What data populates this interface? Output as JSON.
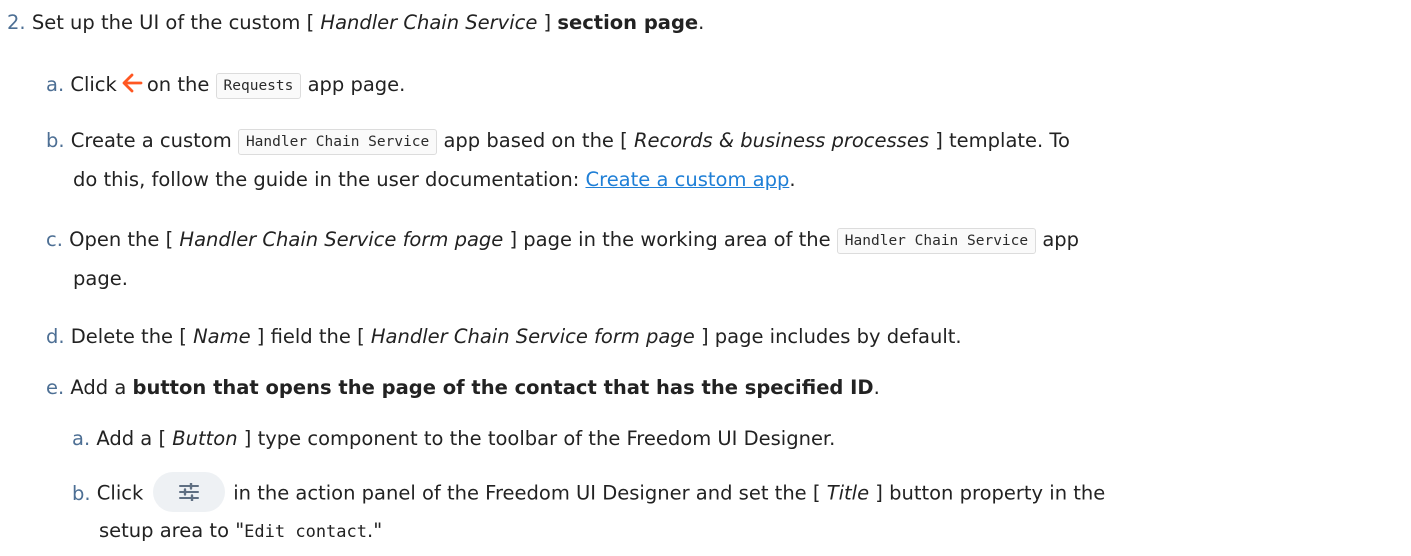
{
  "step2": {
    "marker": "2.",
    "t1": "Set up the UI of the custom [ ",
    "t2": "Handler Chain Service",
    "t3": " ] ",
    "t4": "section page",
    "t5": "."
  },
  "a": {
    "marker": "a.",
    "t1": "Click",
    "icon": "back-arrow-icon",
    "t2": "on the",
    "code": "Requests",
    "t3": "app page."
  },
  "b": {
    "marker": "b.",
    "t1": "Create a custom",
    "code": "Handler Chain Service",
    "t2": "app based on the [ ",
    "t3": "Records & business processes",
    "t4": " ] template. To",
    "line2_t1": "do this, follow the guide in the user documentation: ",
    "link": "Create a custom app",
    "line2_t2": "."
  },
  "c": {
    "marker": "c.",
    "t1": "Open the [ ",
    "t2": "Handler Chain Service form page",
    "t3": " ] page in the working area of the",
    "code": "Handler Chain Service",
    "t4": "app",
    "line2": "page."
  },
  "d": {
    "marker": "d.",
    "t1": "Delete the [ ",
    "t2": "Name",
    "t3": " ] field the [ ",
    "t4": "Handler Chain Service form page",
    "t5": " ] page includes by default."
  },
  "e": {
    "marker": "e.",
    "t1": "Add a ",
    "t2": "button that opens the page of the contact that has the specified ID",
    "t3": "."
  },
  "ea": {
    "marker": "a.",
    "t1": "Add a [ ",
    "t2": "Button",
    "t3": " ] type component to the toolbar of the Freedom UI Designer."
  },
  "eb": {
    "marker": "b.",
    "t1": "Click",
    "icon": "settings-sliders-icon",
    "t2": "in the action panel of the Freedom UI Designer and set the [ ",
    "t3": "Title",
    "t4": " ] button property in the",
    "line2_t1": "setup area to \"",
    "code": "Edit contact",
    "line2_t2": ".\""
  },
  "colors": {
    "marker": "#4d6f94",
    "link": "#1f7fd6",
    "arrow": "#ff5722",
    "button_bg": "#eef1f4"
  }
}
